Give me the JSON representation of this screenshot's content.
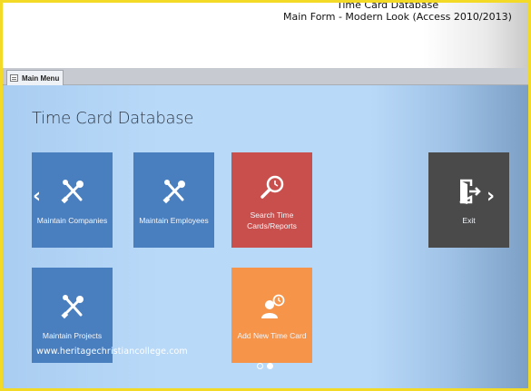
{
  "window": {
    "title_line1": "Time Card Database",
    "title_line2": "Main Form - Modern Look (Access 2010/2013)"
  },
  "tab": {
    "label": "Main Menu",
    "icon": "form-icon"
  },
  "main": {
    "title": "Time Card Database",
    "tiles": [
      {
        "label": "Maintain Companies",
        "icon": "tools-icon",
        "color": "#4a7fbf"
      },
      {
        "label": "Maintain Employees",
        "icon": "tools-icon",
        "color": "#4a7fbf"
      },
      {
        "label": "Search Time Cards/Reports",
        "icon": "search-icon",
        "color": "#c94f4c"
      },
      {
        "label": "Exit",
        "icon": "exit-door-icon",
        "color": "#4a4a4a"
      },
      {
        "label": "Maintain Projects",
        "icon": "tools-icon",
        "color": "#4a7fbf"
      },
      {
        "label": "Add New Time Card",
        "icon": "user-clock-icon",
        "color": "#f6944a"
      }
    ],
    "prev_icon": "chevron-left-icon",
    "next_icon": "chevron-right-icon",
    "pagination": {
      "total": 2,
      "current": 2
    }
  },
  "watermark": "www.heritagechristiancollege.com",
  "colors": {
    "frame": "#f2da27",
    "canvas": "#b9d9f8"
  }
}
